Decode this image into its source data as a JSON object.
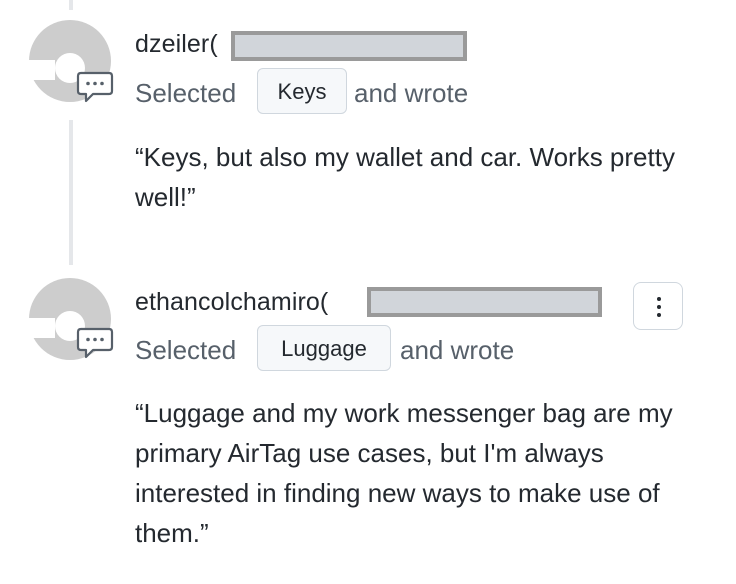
{
  "comments": [
    {
      "username": "dzeiler(",
      "selected_label": "Selected",
      "tag": "Keys",
      "wrote_label": "and wrote",
      "body": "“Keys, but also my wallet and car. Works pretty well!”"
    },
    {
      "username": "ethancolchamiro(",
      "selected_label": "Selected",
      "tag": "Luggage",
      "wrote_label": "and wrote",
      "body": "“Luggage and my work messenger bag are my primary AirTag use cases, but I'm always interested in finding new ways to make use of them.”"
    }
  ],
  "icons": {
    "avatar": "default-avatar-icon",
    "badge": "comment-discussion-icon",
    "more": "kebab-horizontal-icon"
  }
}
